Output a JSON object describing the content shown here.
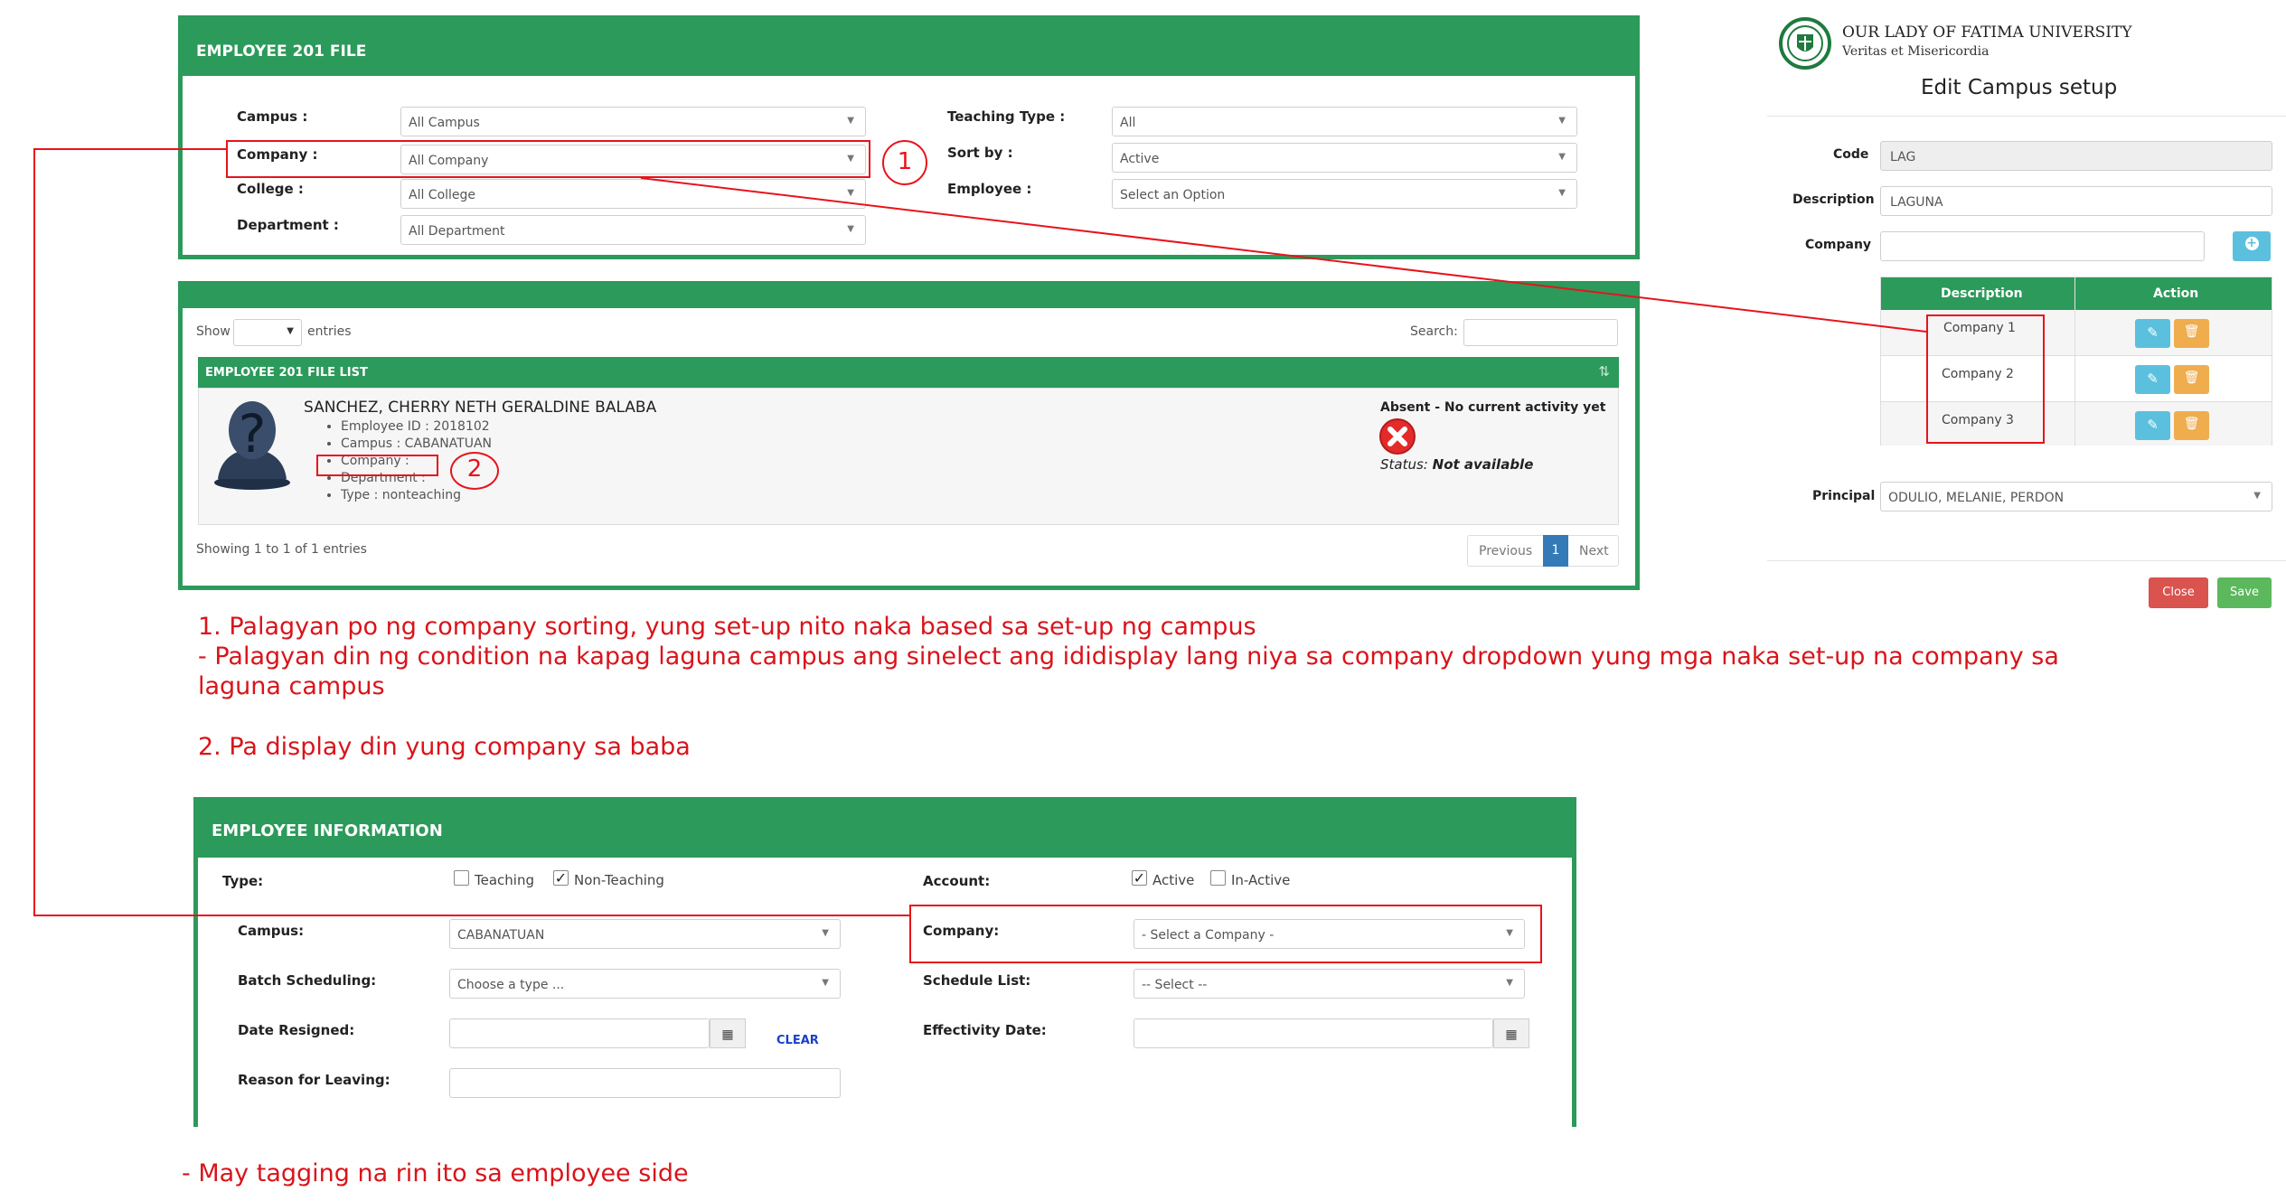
{
  "filter_panel": {
    "title": "EMPLOYEE 201 FILE",
    "campus": {
      "label": "Campus :",
      "value": "All Campus"
    },
    "company": {
      "label": "Company :",
      "value": "All Company"
    },
    "college": {
      "label": "College :",
      "value": "All College"
    },
    "department": {
      "label": "Department :",
      "value": "All Department"
    },
    "teaching_type": {
      "label": "Teaching Type :",
      "value": "All"
    },
    "sort_by": {
      "label": "Sort by :",
      "value": "Active"
    },
    "employee": {
      "label": "Employee :",
      "value": "Select an Option"
    }
  },
  "list_panel": {
    "show_label": "Show",
    "entries_label": "entries",
    "search_label": "Search:",
    "list_title": "EMPLOYEE 201 FILE LIST",
    "employee": {
      "name": "SANCHEZ, CHERRY NETH GERALDINE BALABA",
      "details": [
        "Employee ID : 2018102",
        "Campus : CABANATUAN",
        "Company :",
        "Department :",
        "Type : nonteaching"
      ],
      "activity": "Absent - No current activity yet",
      "status_label": "Status:",
      "status_value": "Not available"
    },
    "showing": "Showing 1 to 1 of 1 entries",
    "pagination": {
      "previous": "Previous",
      "page": "1",
      "next": "Next"
    }
  },
  "campus_setup": {
    "university_name": "OUR LADY OF FATIMA UNIVERSITY",
    "motto": "Veritas et Misericordia",
    "title": "Edit Campus setup",
    "code": {
      "label": "Code",
      "value": "LAG"
    },
    "description": {
      "label": "Description",
      "value": "LAGUNA"
    },
    "company": {
      "label": "Company",
      "value": ""
    },
    "table": {
      "headers": [
        "Description",
        "Action"
      ],
      "rows": [
        "Company 1",
        "Company 2",
        "Company 3"
      ]
    },
    "principal": {
      "label": "Principal",
      "value": "ODULIO, MELANIE, PERDON"
    },
    "close_label": "Close",
    "save_label": "Save",
    "colors": {
      "primary": "#2c9a5a",
      "info": "#5bc0de",
      "warning": "#f0ad4e",
      "danger": "#d9534f",
      "success": "#5cb85c"
    }
  },
  "notes": {
    "n1_line1": "1. Palagyan po ng company sorting, yung set-up nito naka based sa set-up ng campus",
    "n1_line2": "- Palagyan din ng condition na kapag laguna campus ang sinelect ang ididisplay lang niya sa company dropdown yung mga naka set-up na company sa",
    "n1_line3": "laguna campus",
    "n2": "2. Pa display din yung company sa baba",
    "n3": "- May tagging na rin ito sa employee side",
    "marker1": "1",
    "marker2": "2"
  },
  "info_panel": {
    "title": "EMPLOYEE INFORMATION",
    "type_label": "Type:",
    "teaching_label": "Teaching",
    "non_teaching_label": "Non-Teaching",
    "account_label": "Account:",
    "active_label": "Active",
    "inactive_label": "In-Active",
    "campus": {
      "label": "Campus:",
      "value": "CABANATUAN"
    },
    "company": {
      "label": "Company:",
      "value": "- Select a Company -"
    },
    "batch": {
      "label": "Batch Scheduling:",
      "value": "Choose a type ..."
    },
    "schedule": {
      "label": "Schedule List:",
      "value": "-- Select --"
    },
    "date_resigned_label": "Date Resigned:",
    "clear_label": "CLEAR",
    "effectivity_label": "Effectivity Date:",
    "reason_label": "Reason for Leaving:"
  }
}
